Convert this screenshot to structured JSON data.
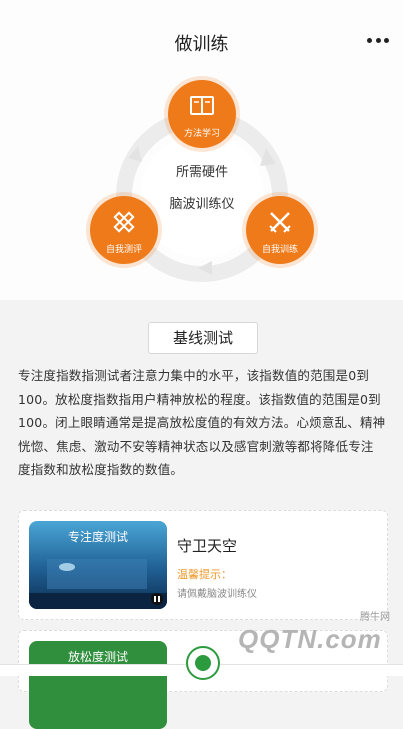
{
  "header": {
    "title": "做训练"
  },
  "cycle": {
    "nodes": [
      {
        "label": "方法学习",
        "icon": "book-icon"
      },
      {
        "label": "自我训练",
        "icon": "crossed-swords-icon"
      },
      {
        "label": "自我测评",
        "icon": "pencil-ruler-icon"
      }
    ],
    "center_lines": [
      "所需硬件",
      "脑波训练仪"
    ],
    "accent": "#ef7a1a"
  },
  "section": {
    "title": "基线测试"
  },
  "description": "专注度指数指测试者注意力集中的水平，该指数值的范围是0到100。放松度指数指用户精神放松的程度。该指数值的范围是0到100。闭上眼睛通常是提高放松度值的有效方法。心烦意乱、精神恍惚、焦虑、激动不安等精神状态以及感官刺激等都将降低专注度指数和放松度指数的数值。",
  "cards": [
    {
      "thumb_caption": "专注度测试",
      "name": "守卫天空",
      "tip": "温馨提示：",
      "sub": "请佩戴脑波训练仪"
    },
    {
      "thumb_caption": "放松度测试"
    }
  ],
  "watermark": {
    "brand": "QQTN.com",
    "small": "腾牛网"
  }
}
